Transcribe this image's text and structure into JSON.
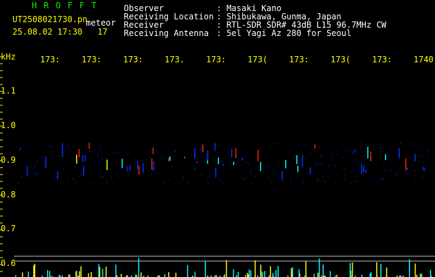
{
  "logo": "HROFFT",
  "file_name": "UT2508021730.pn",
  "category": "meteor",
  "datetime": "25.08.02 17:30",
  "count": "17",
  "station": [
    {
      "label": "Observer",
      "value": ": Masaki Kano"
    },
    {
      "label": "Receiving Location",
      "value": ": Shibukawa, Gunma, Japan"
    },
    {
      "label": "Receiver",
      "value": ": RTL-SDR SDR# 43dB L15 96.7MHz CW"
    },
    {
      "label": "Receiving Antenna",
      "value": ": 5el Yagi Az 280 for Seoul"
    }
  ],
  "freq_unit": "kHz",
  "time_labels": [
    "173:",
    "173:",
    "173:",
    "173.",
    "173:",
    "173(",
    "173:",
    "173(",
    "173:",
    "1740"
  ],
  "freq_labels": [
    "1.1",
    "1.0",
    "0.9",
    "0.8",
    "0.7",
    "0.6"
  ],
  "colors": {
    "background": "#000000",
    "text_yellow": "#ffff00",
    "text_white": "#ffffff",
    "logo_green": "#00ff00",
    "echo_blue": "#0033ff",
    "echo_cyan": "#00ffff",
    "echo_yellow": "#ffff00",
    "echo_red": "#ff2200",
    "grid_line": "#c0c0c0"
  }
}
